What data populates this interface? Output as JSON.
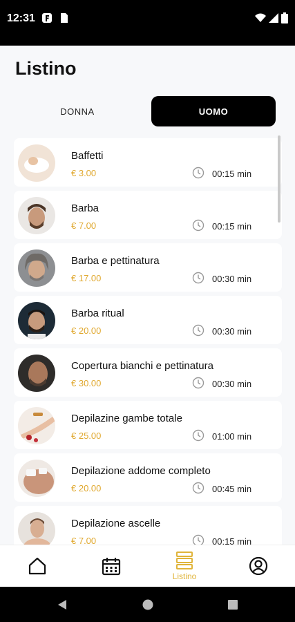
{
  "status_bar": {
    "time": "12:31"
  },
  "header": {
    "title": "Listino"
  },
  "segment": {
    "tab_donna": "DONNA",
    "tab_uomo": "UOMO",
    "selected": "UOMO"
  },
  "services": [
    {
      "name": "Baffetti",
      "price": "€ 3.00",
      "duration": "00:15 min"
    },
    {
      "name": "Barba",
      "price": "€ 7.00",
      "duration": "00:15 min"
    },
    {
      "name": "Barba e pettinatura",
      "price": "€ 17.00",
      "duration": "00:30 min"
    },
    {
      "name": "Barba ritual",
      "price": "€ 20.00",
      "duration": "00:30 min"
    },
    {
      "name": "Copertura bianchi e pettinatura",
      "price": "€ 30.00",
      "duration": "00:30 min"
    },
    {
      "name": "Depilazine gambe totale",
      "price": "€ 25.00",
      "duration": "01:00 min"
    },
    {
      "name": "Depilazione addome completo",
      "price": "€ 20.00",
      "duration": "00:45 min"
    },
    {
      "name": "Depilazione ascelle",
      "price": "€ 7.00",
      "duration": "00:15 min"
    }
  ],
  "tabbar": {
    "items": [
      "home-icon",
      "calendar-icon",
      "list-icon",
      "profile-icon"
    ],
    "active_label": "Listino"
  },
  "colors": {
    "accent": "#e0a82e",
    "active_tab": "#000000"
  }
}
